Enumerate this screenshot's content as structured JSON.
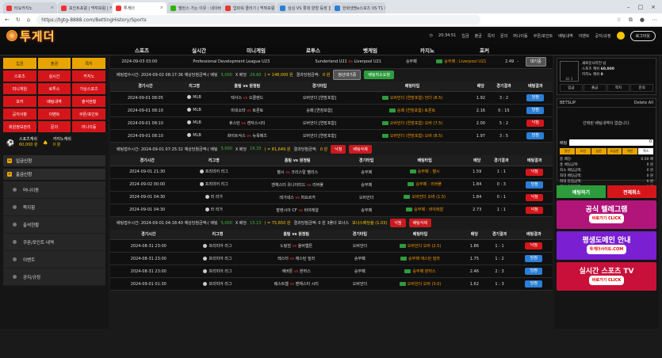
{
  "browser": {
    "tabs": [
      {
        "label": "타요카지노",
        "color": "#e33"
      },
      {
        "label": "포인트포럼 | 먹튀포럼 | 카지노",
        "color": "#e33"
      },
      {
        "label": "투게더",
        "color": "#e33"
      },
      {
        "label": "밸런스 가는 이유 : 네이버 검색",
        "color": "#2db400"
      },
      {
        "label": "업파워 클리기 | 먹튀포럼 | 사",
        "color": "#e33"
      },
      {
        "label": "심심 VS 롯데 양형 등장 합",
        "color": "#2b7fd6"
      },
      {
        "label": "한화생명e스포츠 VS T1 피",
        "color": "#2b7fd6"
      }
    ],
    "url": "https://tgtg-8888.com/BettingHistory/Sports"
  },
  "header": {
    "logo": "투게더",
    "time": "20:34:51",
    "links": [
      "입금",
      "출금",
      "쪽지",
      "문의",
      "머니이동",
      "쿠폰/포인트",
      "베팅내역",
      "이벤트",
      "공지/규정"
    ],
    "logout": "로그아웃"
  },
  "nav": [
    "스포츠",
    "실시간",
    "미니게임",
    "로투스",
    "벳게임",
    "카지노",
    "포커"
  ],
  "sidebar": {
    "grid": [
      {
        "label": "입금",
        "style": "y"
      },
      {
        "label": "출금",
        "style": "y"
      },
      {
        "label": "쪽지",
        "style": "y"
      },
      {
        "label": "스포츠",
        "style": "r"
      },
      {
        "label": "실시간",
        "style": "r"
      },
      {
        "label": "카지노",
        "style": "r"
      },
      {
        "label": "미니게임",
        "style": "r"
      },
      {
        "label": "로투스",
        "style": "r"
      },
      {
        "label": "가상스포츠",
        "style": "r"
      },
      {
        "label": "포커",
        "style": "r"
      },
      {
        "label": "배팅내역",
        "style": "r"
      },
      {
        "label": "출석현황",
        "style": "r"
      },
      {
        "label": "공지사항",
        "style": "r"
      },
      {
        "label": "이벤트",
        "style": "r"
      },
      {
        "label": "쿠폰/포인트",
        "style": "r"
      },
      {
        "label": "회원정보관리",
        "style": "r"
      },
      {
        "label": "문의",
        "style": "r"
      },
      {
        "label": "머니이동",
        "style": "r"
      }
    ],
    "sports_cash_label": "스포츠캐쉬",
    "sports_cash": "60,000 원",
    "casino_cash_label": "카지노캐쉬",
    "casino_cash": "0 원",
    "section1": "입금신청",
    "section2": "출금신청",
    "menu": [
      "머니이동",
      "쪽지함",
      "출석현황",
      "쿠폰/포인트 내역",
      "이벤트",
      "공지/규정"
    ]
  },
  "content": {
    "top_row": {
      "date": "2024-09-03 03:00",
      "league": "Professional Development League U23",
      "home": "Sunderland U21",
      "away": "Liverpool U21",
      "type": "승무패",
      "bet": "승무패 : Liverpool U21",
      "odds": "2.49",
      "score": "-",
      "result": "대기중"
    },
    "headers": [
      "경기시간",
      "리그명",
      "홈팀 vs 원정팀",
      "경기타입",
      "베팅타입",
      "배당",
      "경기결과",
      "베팅결과"
    ],
    "groups": [
      {
        "summary": {
          "label": "베팅접수시간: 2024-09-02 08:17:36 예상당첨금액:( 베팅",
          "amt": "5,000",
          "x": "X 배당",
          "odds": "29.60",
          "eq": ") = 148,000 원",
          "res": "결과당첨금액:",
          "paid": "0 원"
        },
        "buttons": [
          {
            "label": "정산대기중",
            "style": "gray"
          },
          {
            "label": "베팅취소요청",
            "style": "grn"
          }
        ],
        "rows": [
          {
            "date": "2024-09-01 08:05",
            "league": "MLB",
            "home": "텍사스",
            "away": "오클랜드",
            "type": "오버언더 [연장포함]",
            "bet": "오버언더 (연장포함) 언더 (8.5)",
            "odds": "1.92",
            "score": "3 : 2",
            "result": "당첨",
            "win": true
          },
          {
            "date": "2024-09-01 08:10",
            "league": "MLB",
            "home": "미네소타",
            "away": "토론토",
            "type": "승패 [연장포함]",
            "bet": "승패 (연장포함) 토론토",
            "odds": "2.16",
            "score": "0 : 15",
            "result": "당첨",
            "win": true
          },
          {
            "date": "2024-09-01 08:10",
            "league": "MLB",
            "home": "휴스턴",
            "away": "캔자스시티",
            "type": "오버언더 [연장포함]",
            "bet": "오버언더 (연장포함) 오버 (7.5)",
            "odds": "2.00",
            "score": "5 : 2",
            "result": "낙첨",
            "win": false
          },
          {
            "date": "2024-09-01 08:10",
            "league": "MLB",
            "home": "화이트삭스",
            "away": "뉴욕메츠",
            "type": "오버언더 [연장포함]",
            "bet": "오버언더 (연장포함) 오버 (8.5)",
            "odds": "1.97",
            "score": "3 : 5",
            "result": "당첨",
            "win": true
          }
        ]
      },
      {
        "summary": {
          "label": "베팅접수시간: 2024-09-01 07:25:32 예상당첨금액:( 베팅",
          "amt": "5,000",
          "x": "X 배당",
          "odds": "16.33",
          "eq": ") = 81,649 원",
          "res": "결과당첨금액:",
          "paid": "0 원"
        },
        "buttons": [
          {
            "label": "낙첨",
            "style": "red"
          },
          {
            "label": "베팅삭제",
            "style": "red"
          }
        ],
        "rows": [
          {
            "date": "2024-09-01 21:30",
            "league": "프리미어 리그",
            "home": "첼시",
            "away": "크리스탈 팰리스",
            "type": "승무패",
            "bet": "승무패 : 첼시",
            "odds": "1.59",
            "score": "1 : 1",
            "result": "낙첨",
            "win": false
          },
          {
            "date": "2024-09-02 00:00",
            "league": "프리미어 리그",
            "home": "맨체스터 유나이티드",
            "away": "리버풀",
            "type": "승무패",
            "bet": "승무패 : 리버풀",
            "odds": "1.84",
            "score": "0 : 3",
            "result": "당첨",
            "win": true
          },
          {
            "date": "2024-09-01 04:30",
            "league": "라 리가",
            "home": "레가네스",
            "away": "마요르카",
            "type": "오버언더",
            "bet": "오버언더 오버 (1.5)",
            "odds": "1.84",
            "score": "0 : 1",
            "result": "낙첨",
            "win": false
          },
          {
            "date": "2024-09-01 04:30",
            "league": "라 리가",
            "home": "발렌시아 CF",
            "away": "비야레알",
            "type": "승무패",
            "bet": "승무패 : 비야레알",
            "odds": "2.73",
            "score": "1 : 1",
            "result": "낙첨",
            "win": false
          }
        ]
      },
      {
        "summary": {
          "label": "베팅접수시간: 2024-09-01 04:18:40 예상당첨금액:( 베팅",
          "amt": "5,000",
          "x": "X 배당",
          "odds": "15.13",
          "eq": ") = 75,650 원",
          "res": "결과당첨금액: 0 원 3폴더 보너스",
          "paid": "보너스배당율 (1.03)"
        },
        "buttons": [
          {
            "label": "낙첨",
            "style": "red"
          },
          {
            "label": "베팅삭제",
            "style": "red"
          }
        ],
        "rows": [
          {
            "date": "2024-08-31 23:00",
            "league": "프리미어 리그",
            "home": "노팅엄",
            "away": "울버햄튼",
            "type": "오버언더",
            "bet": "오버언더 오버 (2.5)",
            "odds": "1.86",
            "score": "1 : 1",
            "result": "낙첨",
            "win": false
          },
          {
            "date": "2024-08-31 23:00",
            "league": "프리미어 리그",
            "home": "레스터",
            "away": "애스턴 빌라",
            "type": "승무패",
            "bet": "승무패 애스턴 빌라",
            "odds": "1.75",
            "score": "1 : 2",
            "result": "당첨",
            "win": true
          },
          {
            "date": "2024-08-31 23:00",
            "league": "프리미어 리그",
            "home": "에버튼",
            "away": "본머스",
            "type": "승무패",
            "bet": "승무패 본머스",
            "odds": "2.46",
            "score": "2 : 3",
            "result": "당첨",
            "win": true
          },
          {
            "date": "2024-09-01 01:30",
            "league": "프리미어 리그",
            "home": "웨스트햄",
            "away": "맨체스터 시티",
            "type": "오버언더",
            "bet": "오버언더 오버 (3.0)",
            "odds": "1.62",
            "score": "1 : 3",
            "result": "당첨",
            "win": true
          }
        ]
      }
    ]
  },
  "right": {
    "user": "새로운사라진 님",
    "level": "LV. 1",
    "sports_label": "스포츠 캐쉬",
    "sports_val": "60,000",
    "casino_label": "카지노 캐쉬",
    "casino_val": "0",
    "buttons": [
      "입금",
      "출금",
      "쪽지",
      "문의"
    ],
    "betslip": "BETSLIP",
    "delete_all": "Delete All",
    "empty": "선택된 배팅내역이 없습니다.",
    "bet_label": "배팅",
    "bet_value": "0",
    "chips": [
      "일만",
      "오만",
      "십만",
      "오십만",
      "백만",
      "맥스"
    ],
    "stats": [
      [
        "총 배당:",
        "0.00 배"
      ],
      [
        "총 베팅금액:",
        "0 원"
      ],
      [
        "최소 베팅금액:",
        "0 원"
      ],
      [
        "최대 베팅금액:",
        "0 원"
      ],
      [
        "최대 당첨금액:",
        "0 원"
      ],
      [
        "예상 당첨금액:",
        "0 원"
      ]
    ],
    "bet_button": "배팅하기",
    "cancel_button": "전체취소",
    "banners": [
      {
        "title": "공식 텔레그램",
        "sub": "바로가기 CLICK",
        "bg": "#b1157a"
      },
      {
        "title": "평생도메인 안내",
        "sub": "투게더사이트.COM",
        "bg": "#7a1fd1"
      },
      {
        "title": "실시간 스포츠 TV",
        "sub": "바로가기 CLICK",
        "bg": "#c8103a"
      }
    ]
  }
}
